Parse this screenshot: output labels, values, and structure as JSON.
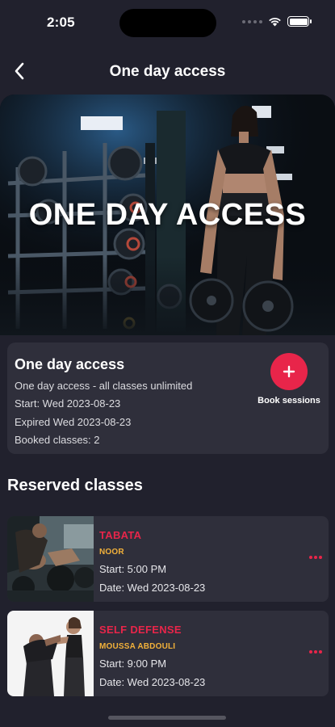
{
  "status_bar": {
    "time": "2:05"
  },
  "header": {
    "title": "One day access",
    "back_icon": "chevron-left-icon"
  },
  "hero": {
    "text": "ONE DAY ACCESS"
  },
  "membership": {
    "title": "One day access",
    "description": "One day access - all classes unlimited",
    "start": "Start: Wed 2023-08-23",
    "expired": "Expired Wed 2023-08-23",
    "booked": "Booked classes: 2",
    "book_button_icon": "plus-icon",
    "book_label": "Book sessions"
  },
  "reserved": {
    "title": "Reserved classes",
    "classes": [
      {
        "name": "TABATA",
        "coach": "NOOR",
        "start": "Start: 5:00 PM",
        "date": "Date: Wed 2023-08-23"
      },
      {
        "name": "SELF DEFENSE",
        "coach": "MOUSSA ABDOULI",
        "start": "Start: 9:00 PM",
        "date": "Date: Wed 2023-08-23"
      }
    ]
  },
  "colors": {
    "background": "#21212d",
    "card": "#2f2f3b",
    "accent_red": "#e8254a",
    "coach_orange": "#f2b13a"
  }
}
